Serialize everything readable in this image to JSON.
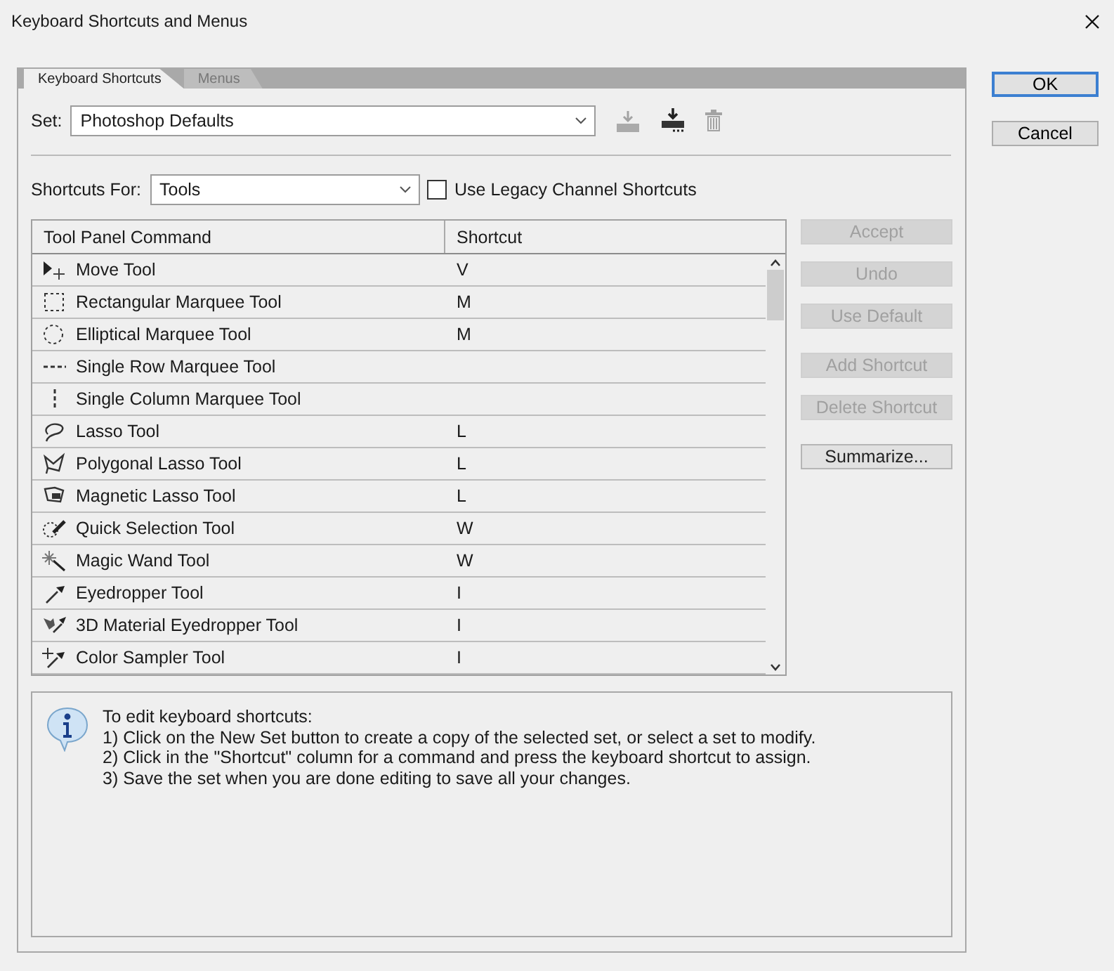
{
  "window": {
    "title": "Keyboard Shortcuts and Menus"
  },
  "tabs": [
    {
      "label": "Keyboard Shortcuts",
      "selected": true
    },
    {
      "label": "Menus",
      "selected": false
    }
  ],
  "set": {
    "label": "Set:",
    "value": "Photoshop Defaults"
  },
  "set_actions": [
    {
      "kind": "save",
      "disabled": true
    },
    {
      "kind": "new",
      "disabled": false
    },
    {
      "kind": "delete",
      "disabled": true
    }
  ],
  "shortcuts_for": {
    "label": "Shortcuts For:",
    "value": "Tools"
  },
  "legacy_checkbox": {
    "label": "Use Legacy Channel Shortcuts",
    "checked": false
  },
  "table": {
    "columns": [
      "Tool Panel Command",
      "Shortcut"
    ],
    "rows": [
      {
        "kind": "move",
        "command": "Move Tool",
        "shortcut": "V"
      },
      {
        "kind": "rectangle",
        "command": "Rectangular Marquee Tool",
        "shortcut": "M"
      },
      {
        "kind": "ellipse",
        "command": "Elliptical Marquee Tool",
        "shortcut": "M"
      },
      {
        "kind": "row",
        "command": "Single Row Marquee Tool"
      },
      {
        "kind": "column",
        "command": "Single Column Marquee Tool"
      },
      {
        "kind": "lasso",
        "command": "Lasso Tool",
        "shortcut": "L"
      },
      {
        "kind": "polygon",
        "command": "Polygonal Lasso Tool",
        "shortcut": "L"
      },
      {
        "kind": "magnetic",
        "command": "Magnetic Lasso Tool",
        "shortcut": "L"
      },
      {
        "kind": "brush",
        "command": "Quick Selection Tool",
        "shortcut": "W"
      },
      {
        "kind": "wand",
        "command": "Magic Wand Tool",
        "shortcut": "W"
      },
      {
        "kind": "eyedropper",
        "command": "Eyedropper Tool",
        "shortcut": "I"
      },
      {
        "kind": "material",
        "command": "3D Material Eyedropper Tool",
        "shortcut": "I"
      },
      {
        "kind": "sampler",
        "command": "Color Sampler Tool",
        "shortcut": "I"
      }
    ]
  },
  "side_buttons": [
    {
      "label": "Accept",
      "disabled": true
    },
    {
      "label": "Undo",
      "disabled": true
    },
    {
      "label": "Use Default",
      "disabled": true
    },
    {
      "label": "Add Shortcut",
      "disabled": true
    },
    {
      "label": "Delete Shortcut",
      "disabled": true
    },
    {
      "label": "Summarize...",
      "disabled": false
    }
  ],
  "info": {
    "lines": [
      "To edit keyboard shortcuts:",
      "1) Click on the New Set button to create a copy of the selected set, or select a set to modify.",
      "2) Click in the \"Shortcut\" column for a command and press the keyboard shortcut to assign.",
      "3) Save the set when you are done editing to save all your changes."
    ]
  },
  "dialog_buttons": [
    "OK",
    "Cancel"
  ]
}
